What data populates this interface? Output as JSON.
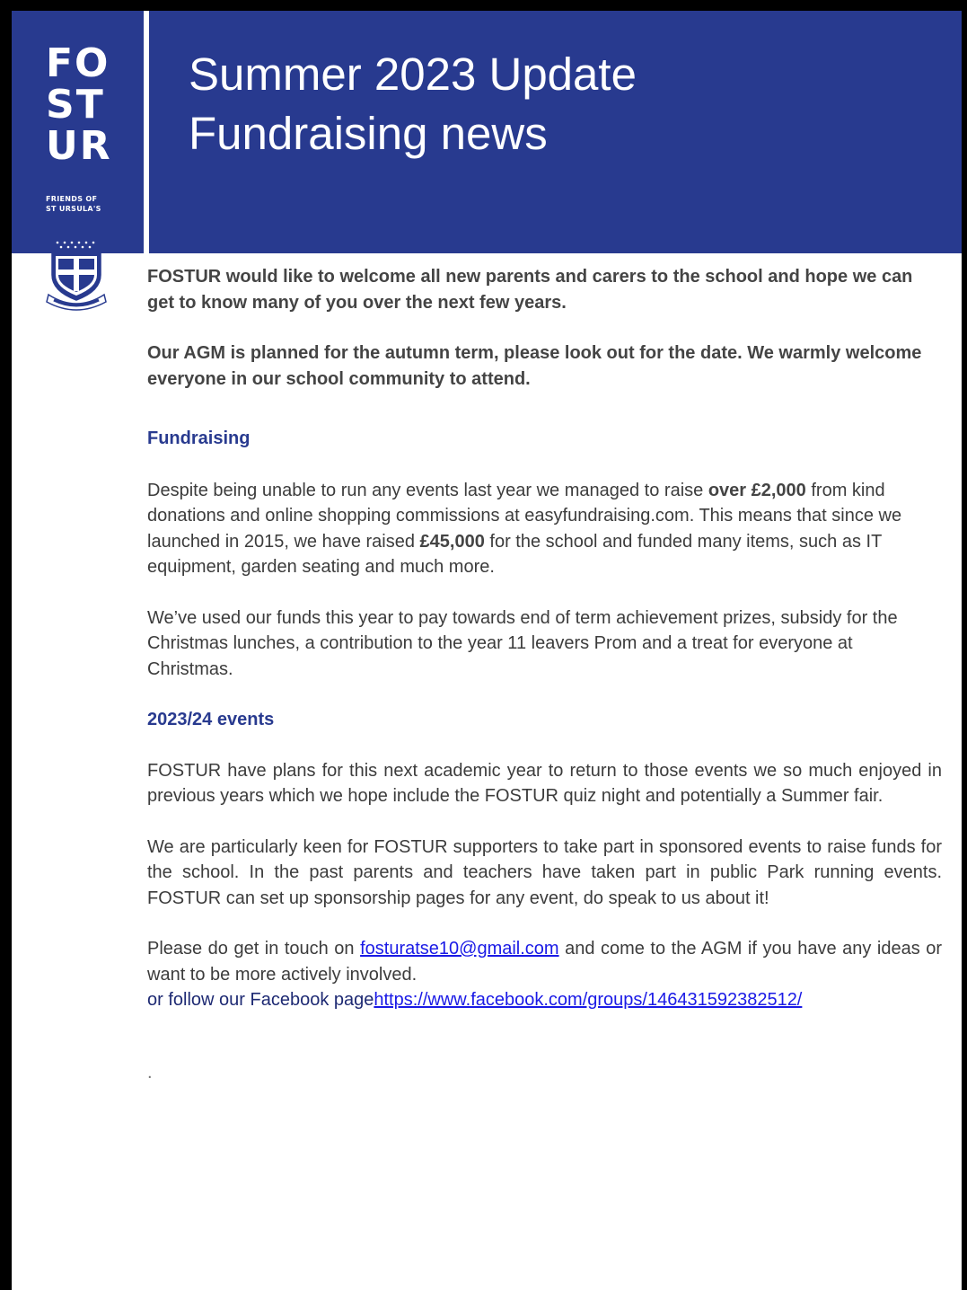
{
  "header": {
    "title_line1": "Summer 2023 Update",
    "title_line2": "Fundraising news",
    "background_color": "#283a8f"
  },
  "logo": {
    "line1": "FO",
    "line2": "ST",
    "line3": "UR",
    "sub1": "FRIENDS OF",
    "sub2": "ST URSULA'S",
    "crest_motto": "SERVIAM"
  },
  "intro": {
    "p1": "FOSTUR would like to welcome all new parents and carers to the school and hope we can get to know many of you over the next few years.",
    "p2": "Our AGM is planned for the autumn term, please look out for the date. We warmly welcome everyone in our school community to attend."
  },
  "fundraising": {
    "heading": "Fundraising",
    "p1_a": "Despite being unable to run any events last year we managed to raise ",
    "p1_b": "over £2,000",
    "p1_c": " from kind donations and online shopping commissions at easyfundraising.com. This means that since we launched in 2015, we have raised ",
    "p1_d": "£45,000",
    "p1_e": " for the school and funded many items, such as IT equipment, garden seating and much more.",
    "p2": "We’ve used our funds this year to pay towards end of term achievement prizes, subsidy for the Christmas lunches, a contribution to the year 11 leavers Prom and a treat for everyone at Christmas."
  },
  "events": {
    "heading": "2023/24 events",
    "p1": "FOSTUR have plans for this next academic year to return to those events we so much enjoyed in previous years which we hope include the FOSTUR quiz night and potentially a Summer fair.",
    "p2": "We are particularly keen for FOSTUR supporters to take part in sponsored events to raise funds for the school. In the past parents and teachers have taken part in public Park running events.  FOSTUR can set up sponsorship pages for any event, do speak to us about it!",
    "contact_a": "Please do get in touch on ",
    "email": "fosturatse10@gmail.com",
    "contact_b": " and come to the AGM if you have any ideas or want to be more actively involved.",
    "facebook_prefix": "or follow our Facebook page",
    "facebook_url": "https://www.facebook.com/groups/146431592382512/",
    "trailing_dot": "."
  }
}
